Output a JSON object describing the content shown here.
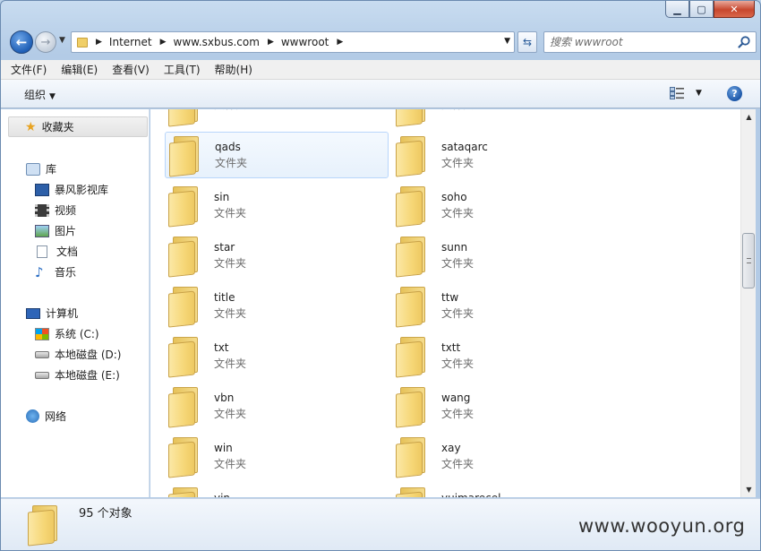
{
  "window": {
    "caption": {
      "minimize": "▁",
      "maximize": "▢",
      "close": "✕"
    }
  },
  "address": {
    "crumbs": [
      "Internet",
      "www.sxbus.com",
      "wwwroot"
    ]
  },
  "search": {
    "placeholder": "搜索 wwwroot"
  },
  "menubar": [
    "文件(F)",
    "编辑(E)",
    "查看(V)",
    "工具(T)",
    "帮助(H)"
  ],
  "toolbar": {
    "organize_label": "组织",
    "help_label": "?"
  },
  "navpane": {
    "favorites": "收藏夹",
    "libraries": "库",
    "library_items": [
      "暴风影视库",
      "视频",
      "图片",
      "文档",
      "音乐"
    ],
    "computer": "计算机",
    "drives": [
      "系统 (C:)",
      "本地磁盘 (D:)",
      "本地磁盘 (E:)"
    ],
    "network": "网络"
  },
  "folder_type_label": "文件夹",
  "files": [
    {
      "name": "",
      "partial": true
    },
    {
      "name": "",
      "partial": true
    },
    {
      "name": "qads",
      "selected": true
    },
    {
      "name": "sataqarc"
    },
    {
      "name": "sin"
    },
    {
      "name": "soho"
    },
    {
      "name": "star"
    },
    {
      "name": "sunn"
    },
    {
      "name": "title"
    },
    {
      "name": "ttw"
    },
    {
      "name": "txt"
    },
    {
      "name": "txtt"
    },
    {
      "name": "vbn"
    },
    {
      "name": "wang"
    },
    {
      "name": "win"
    },
    {
      "name": "xay"
    },
    {
      "name": "yin"
    },
    {
      "name": "yuimarecel"
    }
  ],
  "details": {
    "count": "95 个对象"
  },
  "watermark": "www.wooyun.org",
  "colors": {
    "selection_border": "#b8d6fb",
    "folder": "#f6d777"
  },
  "scroll_position_fraction": 0.35
}
